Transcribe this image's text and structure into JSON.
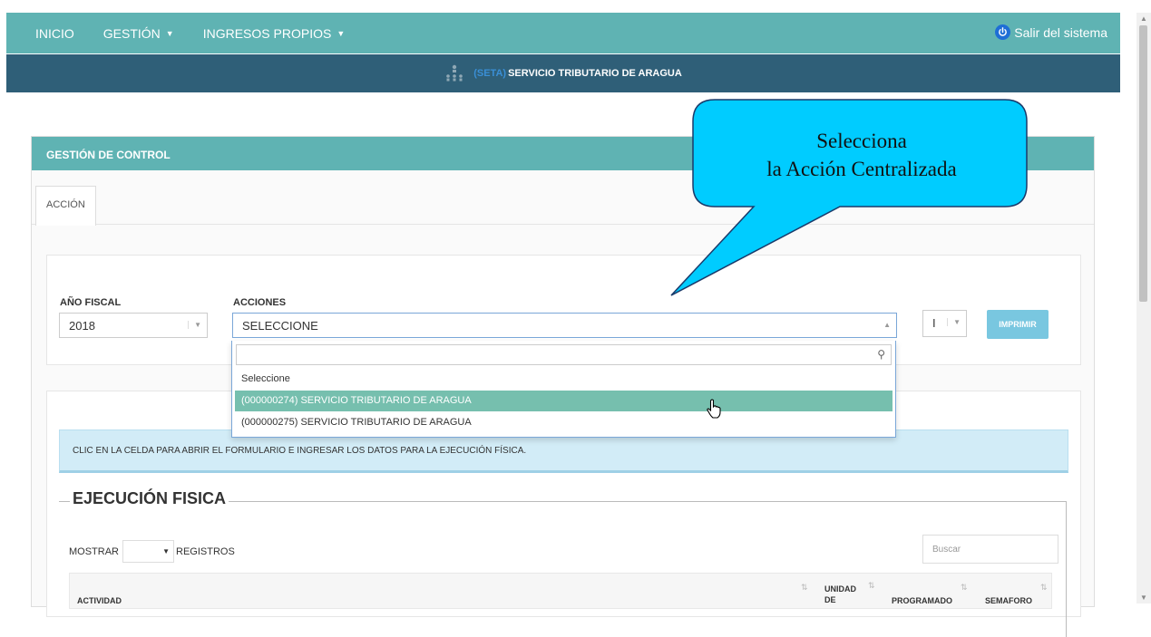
{
  "topnav": {
    "items": [
      {
        "label": "INICIO"
      },
      {
        "label": "GESTIÓN"
      },
      {
        "label": "INGRESOS PROPIOS"
      }
    ],
    "logout_label": "Salir del sistema"
  },
  "banner": {
    "acronym": "(SETA)",
    "title": "SERVICIO TRIBUTARIO DE ARAGUA"
  },
  "panel": {
    "title": "GESTIÓN DE CONTROL",
    "tab_label": "ACCIÓN"
  },
  "filters": {
    "fiscal_year_label": "AÑO FISCAL",
    "fiscal_year_value": "2018",
    "actions_label": "ACCIONES",
    "actions_value": "SELECCIONE",
    "quarter_value": "I",
    "print_label": "IMPRIMIR"
  },
  "dropdown": {
    "options": [
      {
        "label": "Seleccione"
      },
      {
        "label": "(000000274)  SERVICIO TRIBUTARIO DE ARAGUA",
        "highlighted": true
      },
      {
        "label": "(000000275)  SERVICIO TRIBUTARIO DE ARAGUA"
      }
    ]
  },
  "info_text": "CLIC EN LA CELDA PARA ABRIR EL FORMULARIO E INGRESAR LOS DATOS PARA LA EJECUCIÓN FÍSICA.",
  "section": {
    "title": "EJECUCIÓN FISICA",
    "show_label": "MOSTRAR",
    "records_label": "REGISTROS",
    "search_placeholder": "Buscar",
    "columns": {
      "activity": "ACTIVIDAD",
      "unit_line1": "UNIDAD",
      "unit_line2": "DE",
      "programmed": "PROGRAMADO",
      "semaphore": "SEMAFORO"
    }
  },
  "callout": {
    "line1": "Selecciona",
    "line2": "la Acción Centralizada"
  },
  "colors": {
    "nav": "#5fb3b3",
    "banner": "#2f5f78",
    "highlight": "#76bfae",
    "callout": "#00ccff"
  }
}
